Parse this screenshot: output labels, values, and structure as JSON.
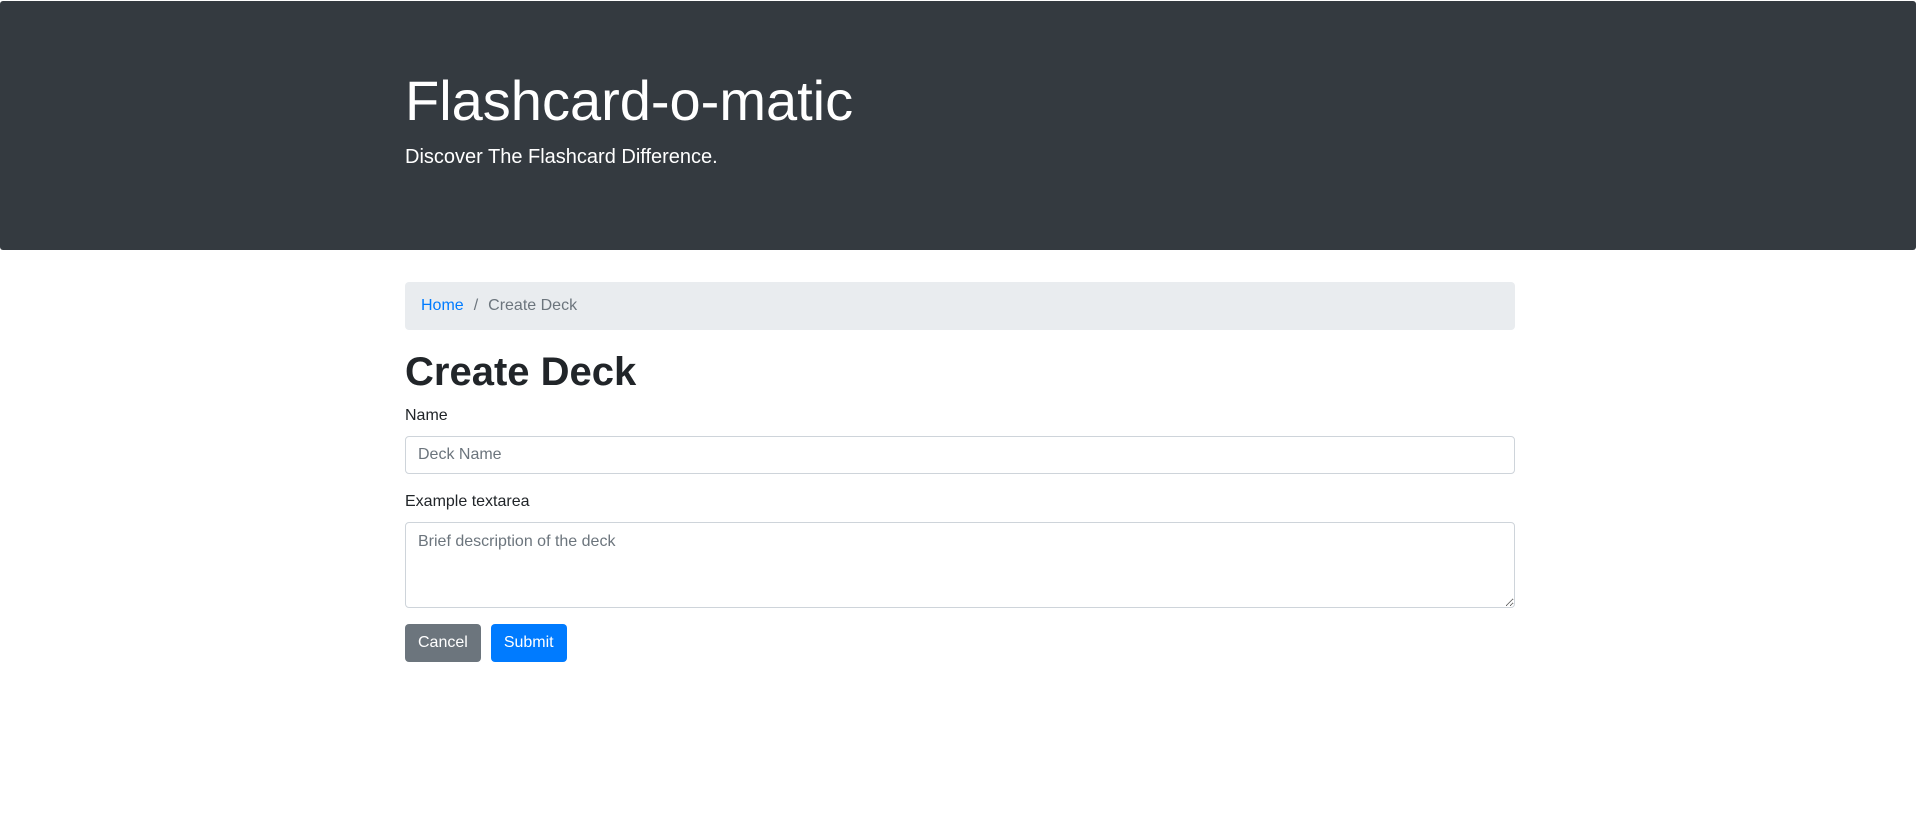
{
  "header": {
    "title": "Flashcard-o-matic",
    "tagline": "Discover The Flashcard Difference."
  },
  "breadcrumb": {
    "home_label": "Home",
    "separator": "/",
    "current_label": "Create Deck"
  },
  "page": {
    "title": "Create Deck"
  },
  "form": {
    "name_label": "Name",
    "name_placeholder": "Deck Name",
    "name_value": "",
    "description_label": "Example textarea",
    "description_placeholder": "Brief description of the deck",
    "description_value": "",
    "cancel_label": "Cancel",
    "submit_label": "Submit"
  },
  "colors": {
    "header_bg": "#343a40",
    "primary": "#007bff",
    "secondary": "#6c757d",
    "breadcrumb_bg": "#e9ecef"
  }
}
